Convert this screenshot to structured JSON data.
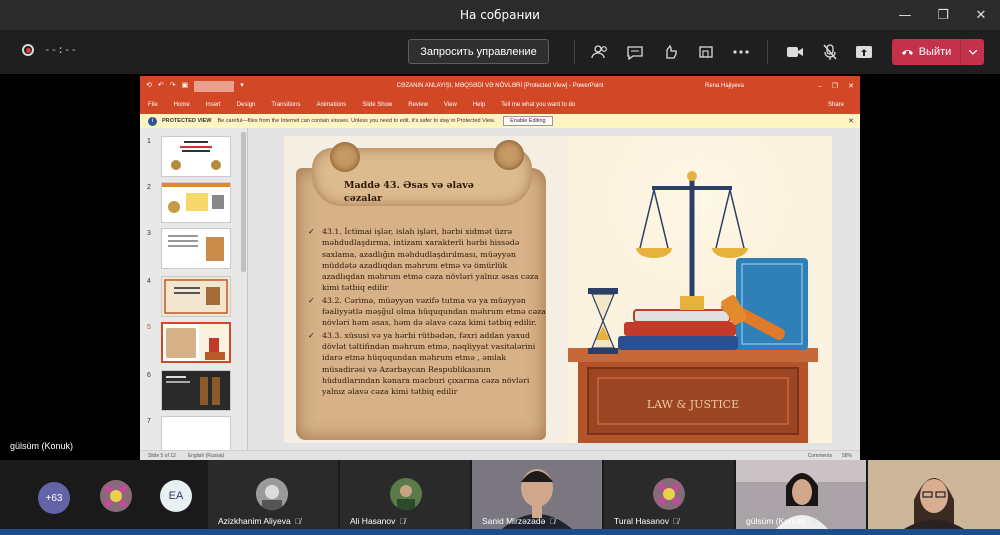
{
  "window": {
    "title": "На собрании",
    "min": "—",
    "restore": "❐",
    "close": "✕"
  },
  "toolbar": {
    "timer": "--:--",
    "request_control": "Запросить управление",
    "leave": "Выйти",
    "icons": [
      "participants-icon",
      "chat-icon",
      "reactions-icon",
      "rooms-icon",
      "more-icon",
      "camera-icon",
      "mic-off-icon",
      "share-icon"
    ]
  },
  "ppt": {
    "title": "CƏZANIN ANLAYIŞI, MƏQSƏDİ VƏ NÖVLƏRİ [Protected View] - PowerPoint",
    "user": "Rena Hajiyeva",
    "ribbon": [
      "File",
      "Home",
      "Insert",
      "Design",
      "Transitions",
      "Animations",
      "Slide Show",
      "Review",
      "View",
      "Help",
      "Tell me what you want to do"
    ],
    "share": "Share",
    "protected_label": "PROTECTED VIEW",
    "protected_msg": "Be careful—files from the Internet can contain viruses. Unless you need to edit, it's safer to stay in Protected View.",
    "enable_editing": "Enable Editing",
    "slide_numbers": [
      "1",
      "2",
      "3",
      "4",
      "5",
      "6",
      "7"
    ],
    "status_left": "Slide 5 of 12",
    "status_lang": "English (Russia)",
    "status_comments": "Comments",
    "status_zoom": "58%"
  },
  "slide": {
    "heading": "Maddə 43. Əsas və əlavə cəzalar",
    "paragraphs": [
      "43.1. İctimai işlər, islah işləri, hərbi xidmət üzrə məhdudlaşdırma, intizam xarakterli hərbi hissədə saxlama, azadlığın məhdudlaşdırılması, müəyyən müddətə azadlıqdan məhrum etmə və ömürlük azadlıqdan məhrum etmə cəza növləri yalnız əsas cəza kimi tətbiq edilir",
      "43.2. Cərimə, müəyyən vəzifə tutma və ya müəyyən fəaliyyətlə məşğul olma hüququndan məhrum etmə cəza növləri həm əsas, həm də əlavə cəza kimi tətbiq edilir.",
      "43.3. xüsusi və ya hərbi rütbədən, fəxri addan yaxud dövlət təltifindən məhrum etmə, nəqliyyat vasitələrini idarə etmə hüququndan məhrum etmə , əmlak müsadirəsi və Azərbaycan Respublikasının hüdudlarından kənara məcburi çıxarma cəza növləri yalnız əlavə cəza kimi tətbiq edilir"
    ],
    "art_caption": "LAW & JUSTICE"
  },
  "presenter": {
    "label": "gülsüm (Konuk)"
  },
  "gallery": {
    "more_count": "+63",
    "participants": [
      {
        "name": "",
        "initials": ""
      },
      {
        "name": "",
        "initials": "EA"
      },
      {
        "name": "Azizkhanim Aliyeva"
      },
      {
        "name": "Ali Hasanov"
      },
      {
        "name": "Sanid Mirzəzadə"
      },
      {
        "name": "Tural Hasanov"
      },
      {
        "name": "gülsüm (Konuk)"
      },
      {
        "name": ""
      }
    ]
  },
  "colors": {
    "leave": "#c4314b",
    "ppt_accent": "#d24726",
    "teams_purple": "#6264a7"
  }
}
